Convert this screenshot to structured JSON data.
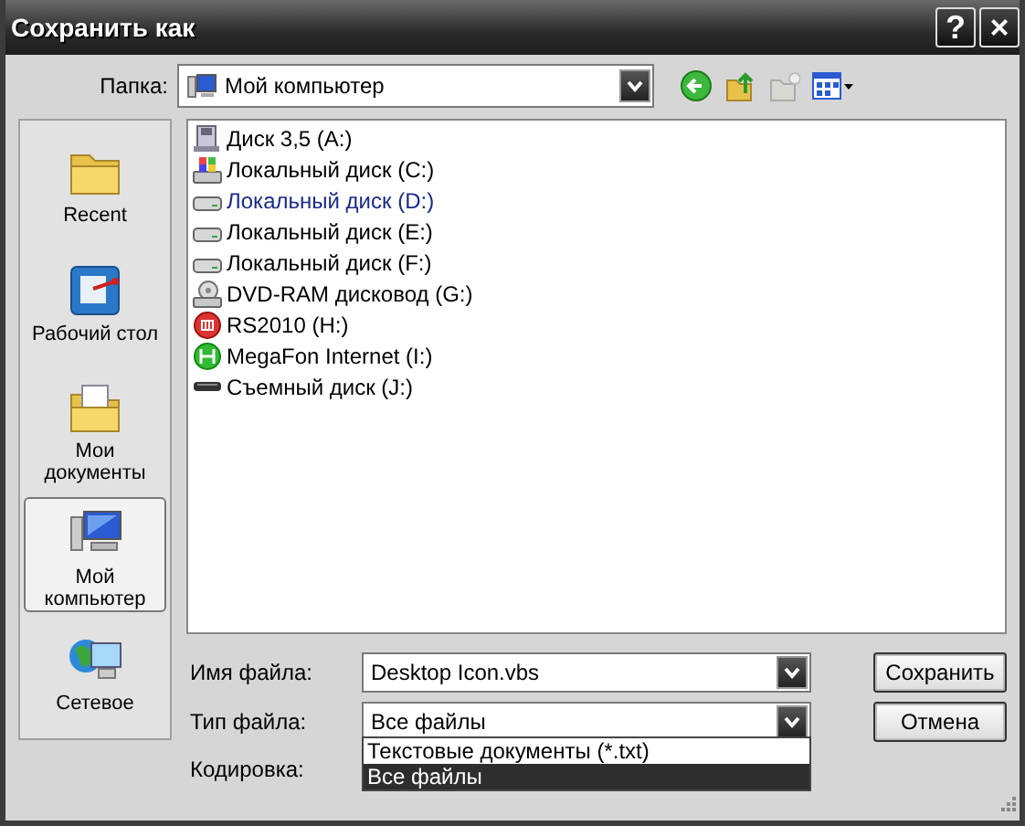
{
  "window": {
    "title": "Сохранить как",
    "buttons": [
      "?",
      "×"
    ]
  },
  "folder": {
    "label": "Папка:",
    "value": "Мой компьютер"
  },
  "places": [
    {
      "kind": "recent",
      "label": "Recent",
      "selected": false
    },
    {
      "kind": "desktop",
      "label": "Рабочий стол",
      "selected": false
    },
    {
      "kind": "documents",
      "label": "Мои документы",
      "selected": false
    },
    {
      "kind": "computer",
      "label": "Мой компьютер",
      "selected": true
    },
    {
      "kind": "network",
      "label": "Сетевое",
      "selected": false
    }
  ],
  "files": [
    {
      "kind": "floppy",
      "name": "Диск 3,5 (A:)",
      "highlighted": false
    },
    {
      "kind": "system",
      "name": "Локальный диск (C:)",
      "highlighted": false
    },
    {
      "kind": "disk",
      "name": "Локальный диск (D:)",
      "highlighted": true
    },
    {
      "kind": "disk",
      "name": "Локальный диск (E:)",
      "highlighted": false
    },
    {
      "kind": "disk",
      "name": "Локальный диск (F:)",
      "highlighted": false
    },
    {
      "kind": "dvd",
      "name": "DVD-RAM дисковод (G:)",
      "highlighted": false
    },
    {
      "kind": "red",
      "name": "RS2010 (H:)",
      "highlighted": false
    },
    {
      "kind": "green",
      "name": "MegaFon Internet (I:)",
      "highlighted": false
    },
    {
      "kind": "removable",
      "name": "Съемный диск (J:)",
      "highlighted": false
    }
  ],
  "filename": {
    "label": "Имя файла:",
    "value": "Desktop Icon.vbs"
  },
  "filetype": {
    "label": "Тип файла:",
    "value": "Все файлы",
    "options": [
      {
        "label": "Текстовые документы (*.txt)",
        "selected": false
      },
      {
        "label": "Все файлы",
        "selected": true
      }
    ]
  },
  "encoding": {
    "label": "Кодировка:"
  },
  "buttons": [
    "Сохранить",
    "Отмена"
  ]
}
